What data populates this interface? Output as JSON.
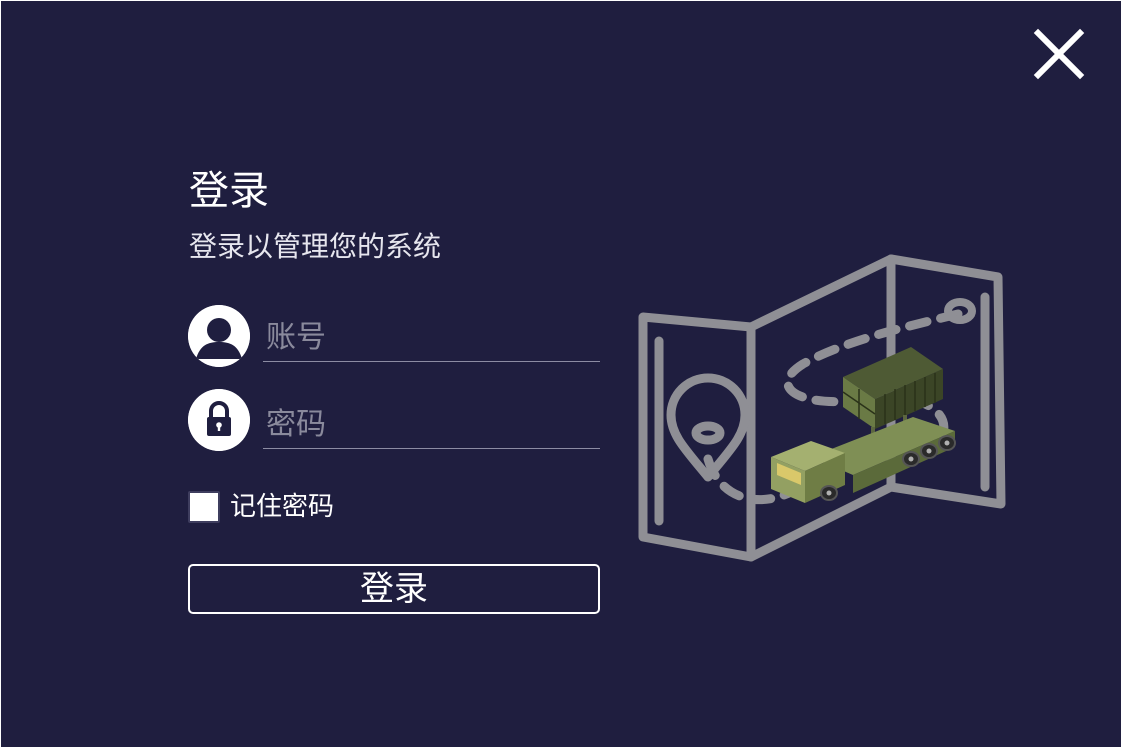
{
  "window": {
    "close_icon": "close-icon",
    "background_color": "#1f1e3f"
  },
  "login": {
    "title": "登录",
    "subtitle": "登录以管理您的系统",
    "username": {
      "icon": "user-avatar-icon",
      "placeholder": "账号",
      "value": ""
    },
    "password": {
      "icon": "lock-icon",
      "placeholder": "密码",
      "value": ""
    },
    "remember": {
      "label": "记住密码",
      "checked": false
    },
    "submit_label": "登录"
  },
  "illustration": {
    "icon": "map-route-missile-launcher-illustration"
  }
}
